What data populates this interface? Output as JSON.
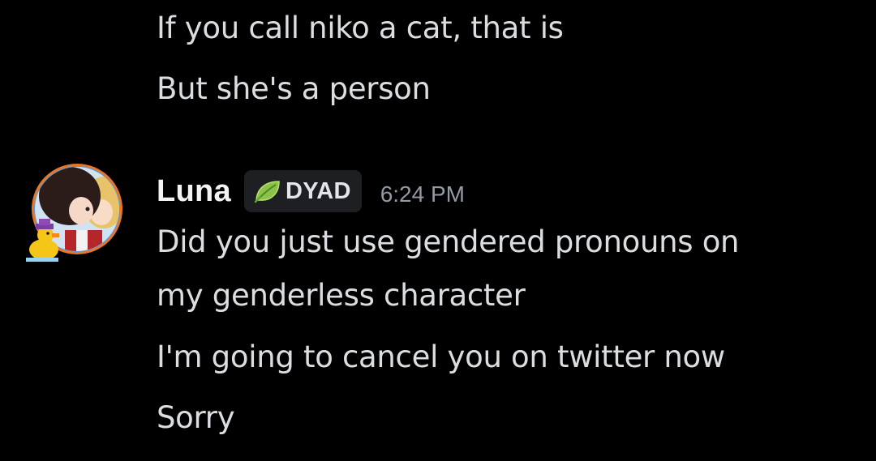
{
  "previous_messages": [
    "If you call niko a cat, that is",
    "But she's a person"
  ],
  "message": {
    "author": "Luna",
    "tag": {
      "label": "DYAD",
      "icon": "leaf-icon"
    },
    "timestamp": "6:24 PM",
    "lines": [
      "Did you just use gendered pronouns on",
      "my genderless character",
      "I'm going to cancel you on twitter now",
      "Sorry"
    ]
  },
  "colors": {
    "background": "#000000",
    "text": "#dbdee1",
    "username": "#f2f3f5",
    "timestamp": "#949ba4",
    "tag_background": "#1e1f22",
    "tag_icon": "#8bc34a"
  }
}
